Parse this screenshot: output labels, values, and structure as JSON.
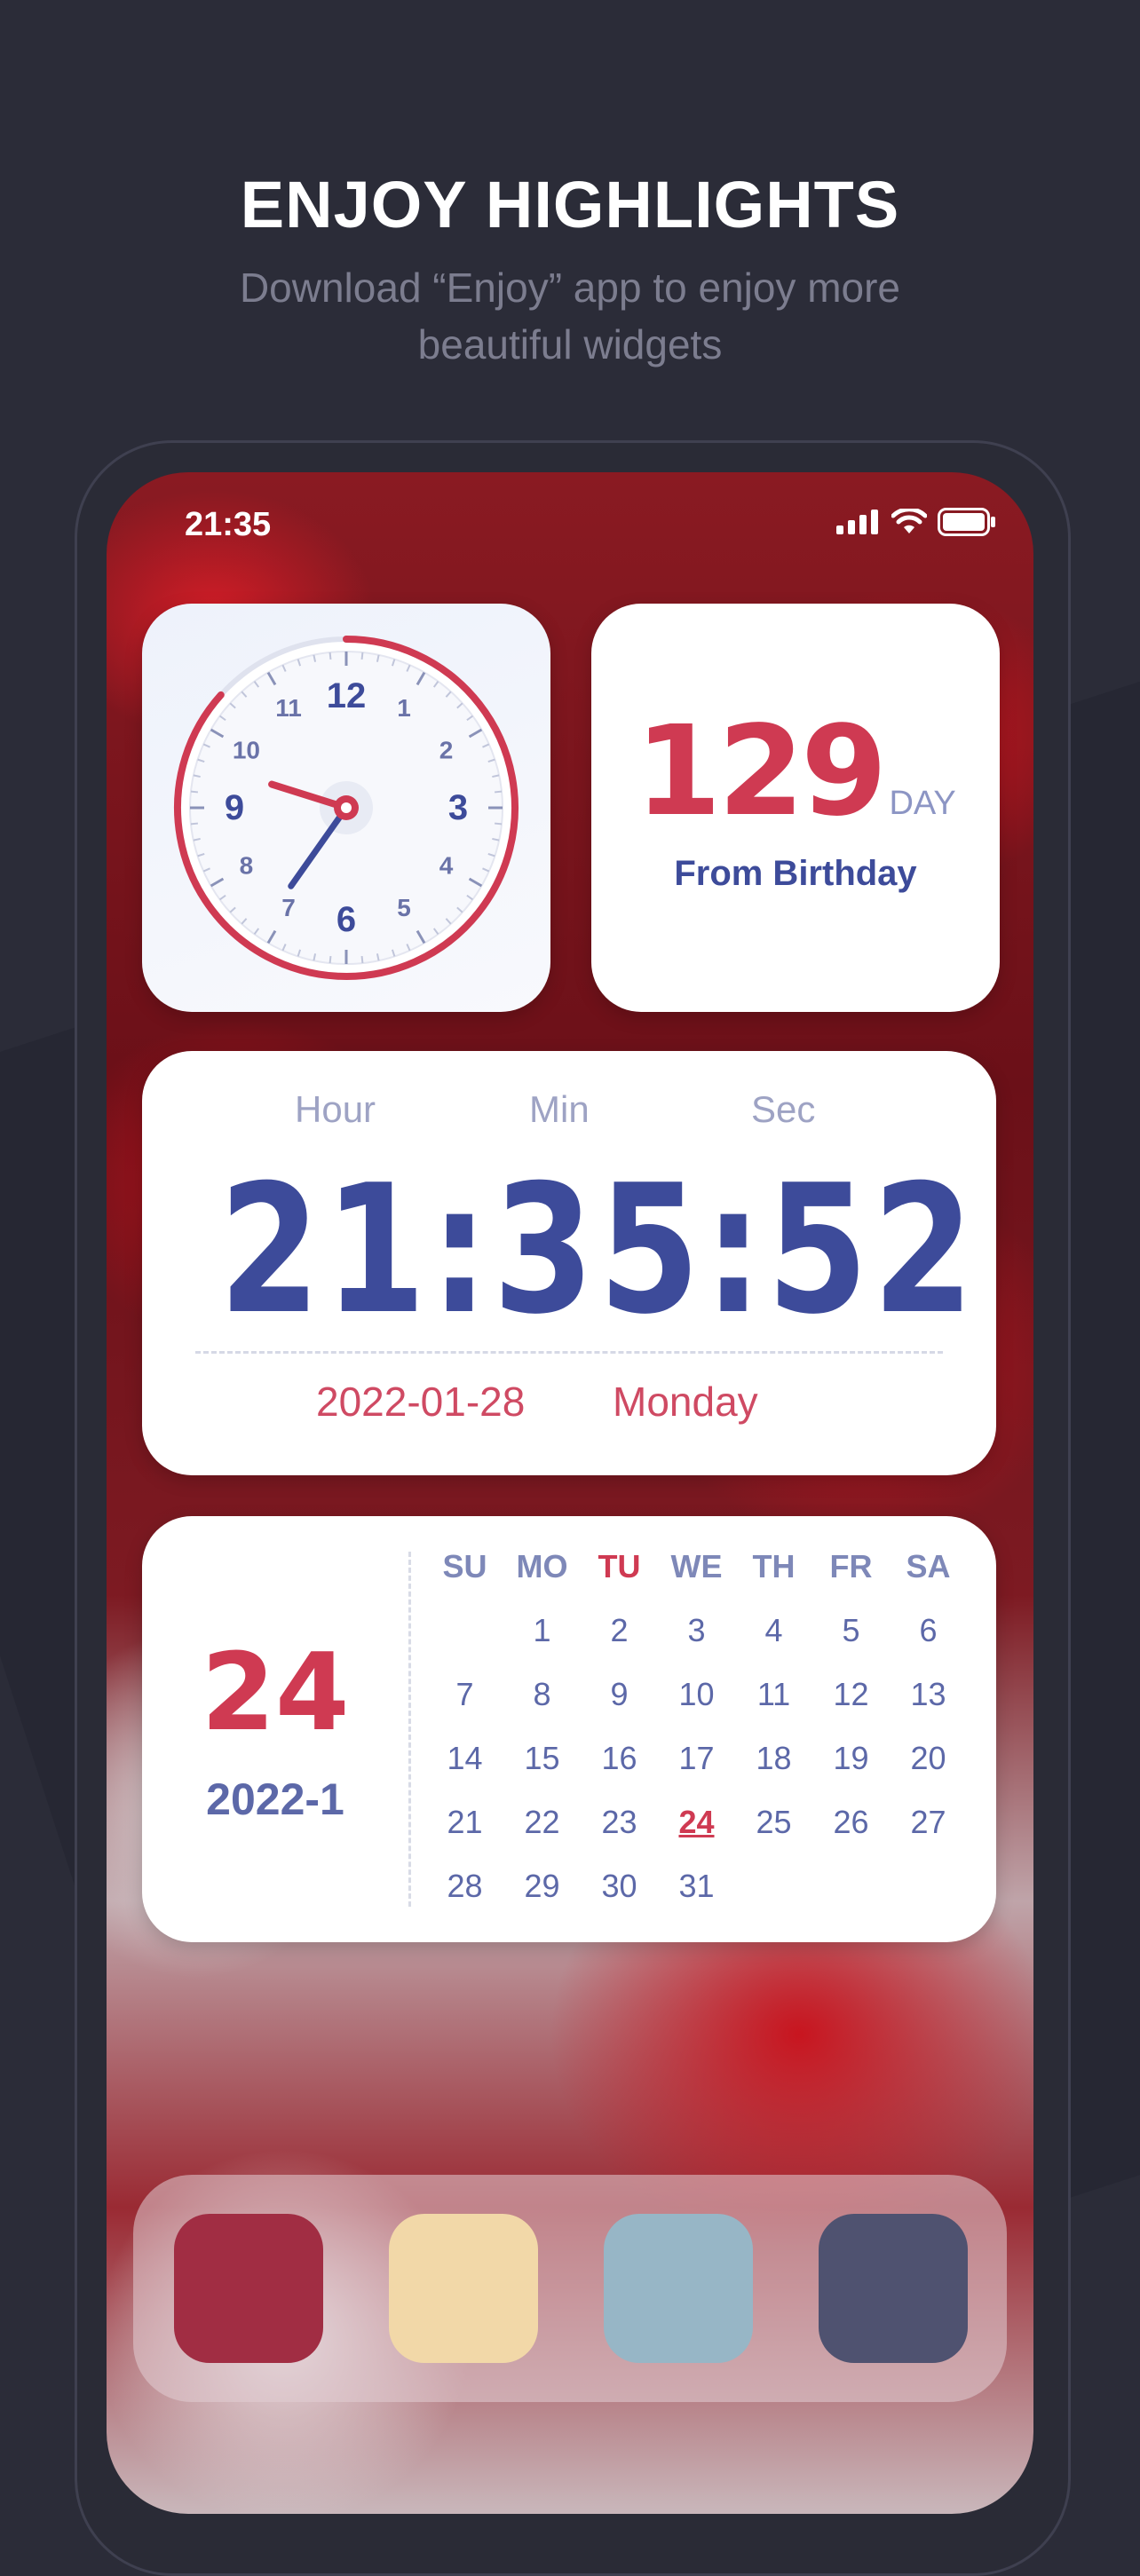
{
  "header": {
    "title": "ENJOY HIGHLIGHTS",
    "subtitle_line1": "Download “Enjoy” app to enjoy more",
    "subtitle_line2": "beautiful widgets"
  },
  "status_bar": {
    "time": "21:35",
    "icons": [
      "signal-icon",
      "wifi-icon",
      "battery-icon"
    ]
  },
  "clock_widget": {
    "numerals": [
      "12",
      "1",
      "2",
      "3",
      "4",
      "5",
      "6",
      "7",
      "8",
      "9",
      "10",
      "11"
    ],
    "hour": 21,
    "minute": 35,
    "second": 52,
    "accent": "#cf3a52",
    "hand_color": "#3d4b9a"
  },
  "birthday_widget": {
    "count": "129",
    "unit": "DAY",
    "label": "From Birthday"
  },
  "time_widget": {
    "labels": {
      "hour": "Hour",
      "min": "Min",
      "sec": "Sec"
    },
    "time": "21:35:52",
    "date": "2022-01-28",
    "weekday": "Monday"
  },
  "calendar_widget": {
    "day": "24",
    "year_month": "2022-1",
    "weekdays": [
      "SU",
      "MO",
      "TU",
      "WE",
      "TH",
      "FR",
      "SA"
    ],
    "highlight_weekday": "TU",
    "start_offset": 1,
    "days_in_month": 31,
    "today": 24
  },
  "dock": {
    "apps": [
      {
        "name": "app-red",
        "color": "#a12d43"
      },
      {
        "name": "app-cream",
        "color": "#f2d8a8"
      },
      {
        "name": "app-blue",
        "color": "#97b6c6"
      },
      {
        "name": "app-slate",
        "color": "#4f5270"
      }
    ]
  },
  "colors": {
    "background": "#2b2c38",
    "accent": "#cf3a52",
    "primary": "#3d4b9a"
  }
}
